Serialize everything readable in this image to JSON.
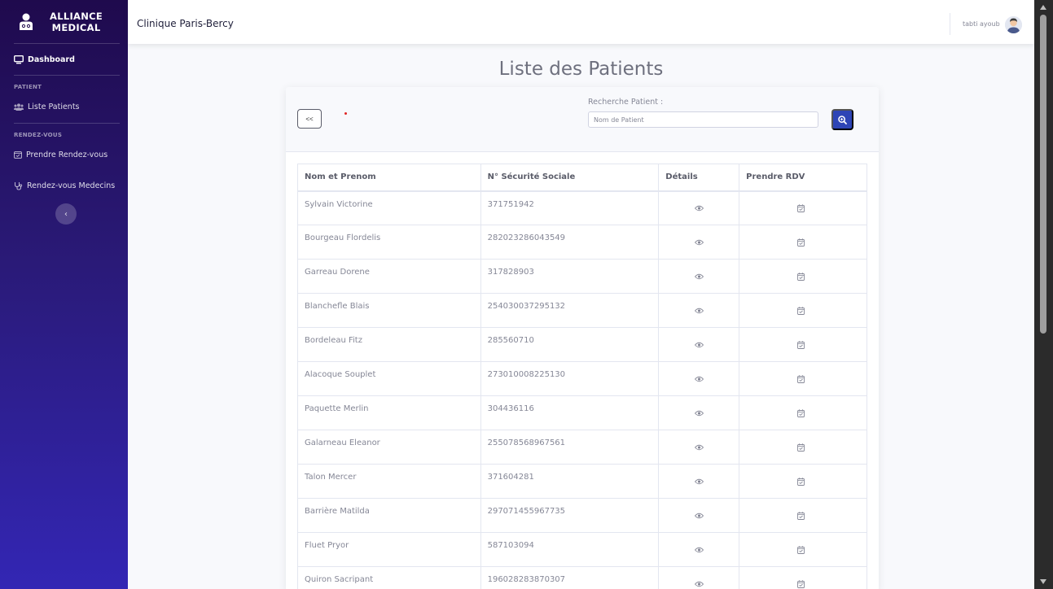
{
  "sidebar": {
    "brand_line1": "ALLIANCE",
    "brand_line2": "MEDICAL",
    "dashboard": "Dashboard",
    "heading_patient": "PATIENT",
    "liste_patients": "Liste Patients",
    "heading_rdv": "RENDEZ-VOUS",
    "prendre_rdv": "Prendre Rendez-vous",
    "rdv_medecins": "Rendez-vous Medecins",
    "toggle": "‹"
  },
  "topbar": {
    "clinic": "Clinique Paris-Bercy",
    "username": "tabti ayoub"
  },
  "page": {
    "title": "Liste des Patients"
  },
  "card": {
    "back": "<<",
    "search_label": "Recherche Patient :",
    "search_placeholder": "Nom de Patient"
  },
  "table": {
    "headers": [
      "Nom et Prenom",
      "N° Sécurité Sociale",
      "Détails",
      "Prendre RDV"
    ],
    "rows": [
      {
        "name": "Sylvain Victorine",
        "ssn": "371751942"
      },
      {
        "name": "Bourgeau Flordelis",
        "ssn": "282023286043549"
      },
      {
        "name": "Garreau Dorene",
        "ssn": "317828903"
      },
      {
        "name": "Blanchefle Blais",
        "ssn": "254030037295132"
      },
      {
        "name": "Bordeleau Fitz",
        "ssn": "285560710"
      },
      {
        "name": "Alacoque Souplet",
        "ssn": "273010008225130"
      },
      {
        "name": "Paquette Merlin",
        "ssn": "304436116"
      },
      {
        "name": "Galarneau Eleanor",
        "ssn": "255078568967561"
      },
      {
        "name": "Talon Mercer",
        "ssn": "371604281"
      },
      {
        "name": "Barrière Matilda",
        "ssn": "297071455967735"
      },
      {
        "name": "Fluet Pryor",
        "ssn": "587103094"
      },
      {
        "name": "Quiron Sacripant",
        "ssn": "196028283870307"
      }
    ]
  },
  "colors": {
    "sidebar_top": "#1f0a4d",
    "sidebar_bottom": "#3326b4",
    "primary_button": "#2e45b6"
  }
}
